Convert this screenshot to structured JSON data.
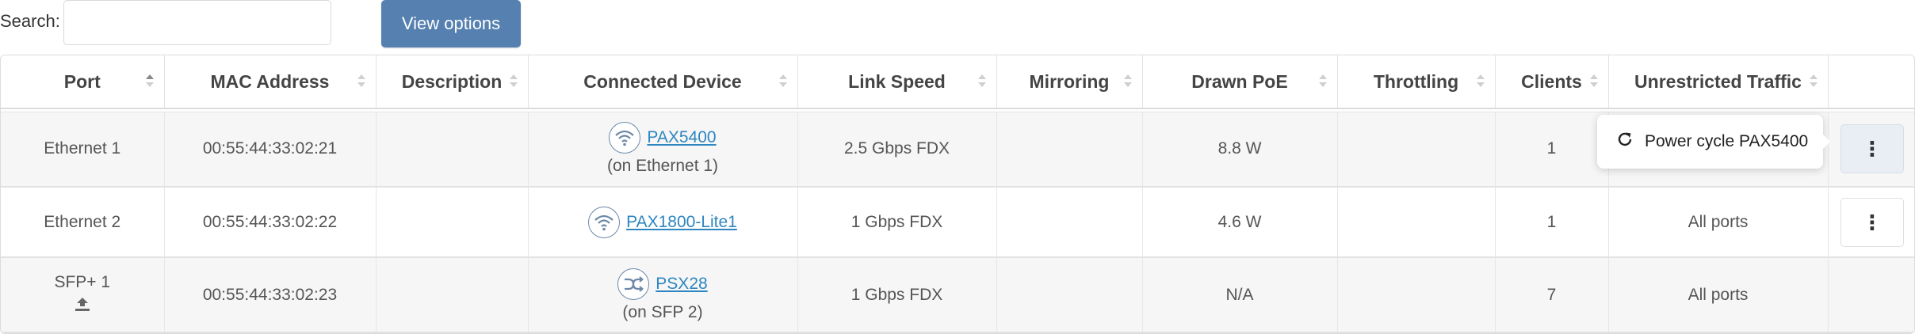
{
  "search": {
    "label": "Search:",
    "placeholder": "",
    "value": ""
  },
  "toolbar": {
    "view_options_label": "View options"
  },
  "table": {
    "columns": [
      "Port",
      "MAC Address",
      "Description",
      "Connected Device",
      "Link Speed",
      "Mirroring",
      "Drawn PoE",
      "Throttling",
      "Clients",
      "Unrestricted Traffic"
    ],
    "sort": {
      "column": "Port",
      "direction": "ascending"
    },
    "rows": [
      {
        "port": "Ethernet 1",
        "mac": "00:55:44:33:02:21",
        "description": "",
        "device_icon": "wifi-icon",
        "device_name": "PAX5400",
        "device_sub": "(on Ethernet 1)",
        "link_speed": "2.5 Gbps FDX",
        "mirroring": "",
        "drawn_poe": "8.8 W",
        "throttling": "",
        "clients": "1",
        "unrestricted": ""
      },
      {
        "port": "Ethernet 2",
        "mac": "00:55:44:33:02:22",
        "description": "",
        "device_icon": "wifi-icon",
        "device_name": "PAX1800-Lite1",
        "device_sub": "",
        "link_speed": "1 Gbps FDX",
        "mirroring": "",
        "drawn_poe": "4.6 W",
        "throttling": "",
        "clients": "1",
        "unrestricted": "All ports"
      },
      {
        "port": "SFP+ 1",
        "port_icon": "uplink-icon",
        "mac": "00:55:44:33:02:23",
        "description": "",
        "device_icon": "switch-icon",
        "device_name": "PSX28",
        "device_sub": "(on SFP 2)",
        "link_speed": "1 Gbps FDX",
        "mirroring": "",
        "drawn_poe": "N/A",
        "throttling": "",
        "clients": "7",
        "unrestricted": "All ports"
      }
    ]
  },
  "popover": {
    "icon": "refresh-icon",
    "label": "Power cycle PAX5400"
  },
  "colors": {
    "accent": "#5580b0",
    "link": "#2e86c1",
    "row_alt": "#f6f6f6"
  }
}
